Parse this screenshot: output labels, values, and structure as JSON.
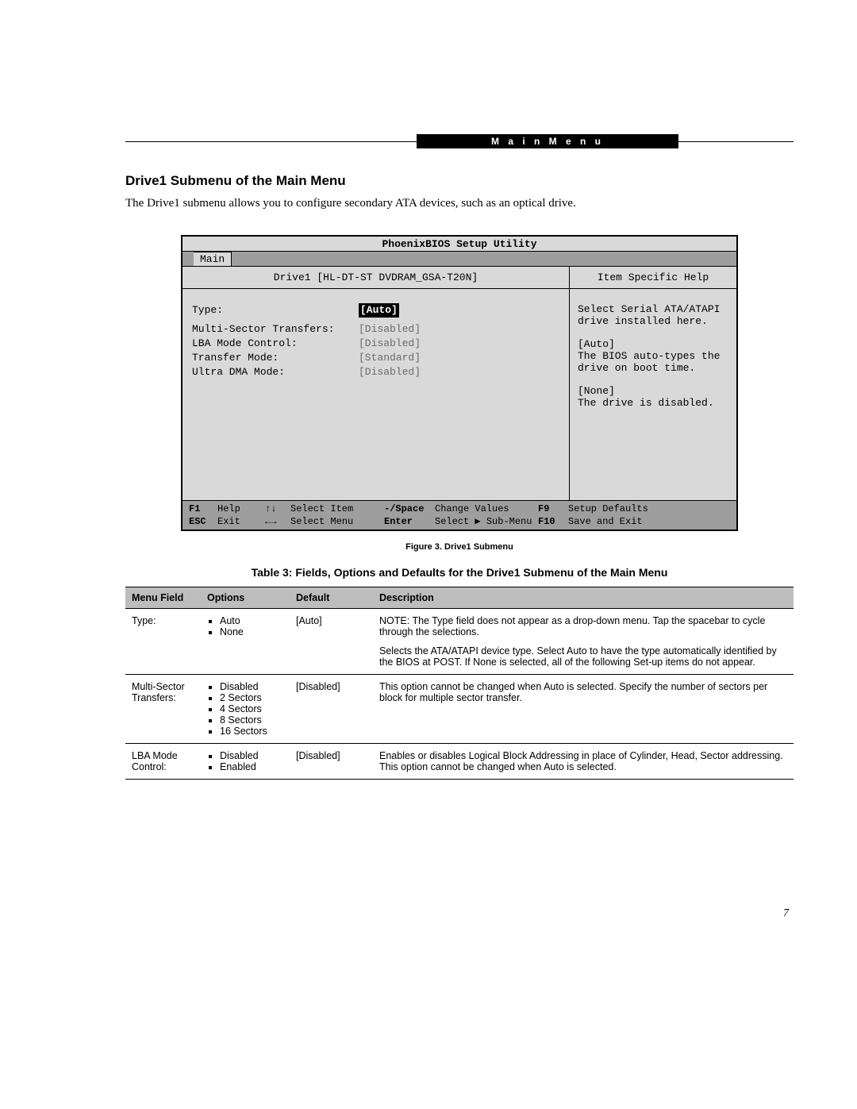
{
  "header": {
    "pill": "M a i n   M e n u"
  },
  "section_title": "Drive1 Submenu of the Main Menu",
  "intro": "The Drive1 submenu allows you to configure secondary ATA devices, such as an optical drive.",
  "bios": {
    "title": "PhoenixBIOS Setup Utility",
    "tab": "Main",
    "drive_header": "Drive1 [HL-DT-ST DVDRAM_GSA-T20N]",
    "help_header": "Item Specific Help",
    "rows": {
      "type": {
        "label": "Type:",
        "value": "[Auto]"
      },
      "mst": {
        "label": "Multi-Sector Transfers:",
        "value": "[Disabled]"
      },
      "lba": {
        "label": "LBA Mode Control:",
        "value": "[Disabled]"
      },
      "tm": {
        "label": "Transfer Mode:",
        "value": "[Standard]"
      },
      "udma": {
        "label": "Ultra DMA Mode:",
        "value": "[Disabled]"
      }
    },
    "help": {
      "l1": "Select Serial ATA/ATAPI",
      "l2": "drive installed here.",
      "l3": "[Auto]",
      "l4": "The BIOS auto-types the",
      "l5": "drive on boot time.",
      "l6": "[None]",
      "l7": "The drive is disabled."
    },
    "foot": {
      "f1k": "F1",
      "f1": "Help",
      "a1": "↑↓",
      "t1": "Select Item",
      "k1": "-/Space",
      "v1": "Change Values",
      "f9k": "F9",
      "f9": "Setup Defaults",
      "esck": "ESC",
      "esc": "Exit",
      "a2": "←→",
      "t2": "Select Menu",
      "k2": "Enter",
      "v2": "Select ▶ Sub-Menu",
      "f10k": "F10",
      "f10": "Save and Exit"
    }
  },
  "figure_caption": "Figure 3.  Drive1 Submenu",
  "table_caption": "Table 3: Fields, Options and Defaults for the Drive1 Submenu of the Main Menu",
  "table": {
    "head": {
      "c1": "Menu Field",
      "c2": "Options",
      "c3": "Default",
      "c4": "Description"
    },
    "rows": [
      {
        "field": "Type:",
        "options": [
          "Auto",
          "None"
        ],
        "def": "[Auto]",
        "desc": "NOTE: The Type field does not appear as a drop-down menu. Tap the spacebar to cycle through the selections.\n\nSelects the ATA/ATAPI device type. Select Auto to have the type automatically identified by the BIOS at POST. If None is selected, all of the following Set-up items do not appear."
      },
      {
        "field": "Multi-Sector Transfers:",
        "options": [
          "Disabled",
          "2 Sectors",
          "4 Sectors",
          "8 Sectors",
          "16 Sectors"
        ],
        "def": "[Disabled]",
        "desc": "This option cannot be changed when Auto is selected. Specify the number of sectors per block for multiple sector transfer."
      },
      {
        "field": "LBA Mode Control:",
        "options": [
          "Disabled",
          "Enabled"
        ],
        "def": "[Disabled]",
        "desc": "Enables or disables Logical Block Addressing in place of Cylinder, Head, Sector addressing. This option cannot be changed when Auto is selected."
      }
    ]
  },
  "page_number": "7"
}
